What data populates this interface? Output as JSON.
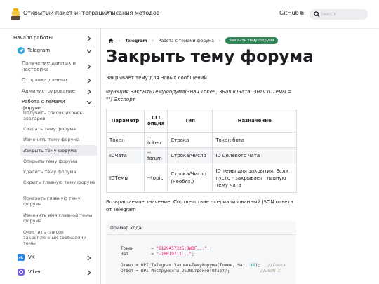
{
  "navbar": {
    "brand": "Открытый пакет интеграций",
    "methods_link": "Описания методов",
    "github": "GitHub",
    "search_placeholder": "Search"
  },
  "sidebar": {
    "items": [
      {
        "label": "Начало работы"
      },
      {
        "label": "Telegram"
      },
      {
        "label": "Получение данных и настройка"
      },
      {
        "label": "Отправка данных"
      },
      {
        "label": "Администрирование"
      },
      {
        "label": "Работа с темами форума"
      },
      {
        "label": "VK"
      },
      {
        "label": "Viber"
      }
    ],
    "sub_items": [
      {
        "label": "Получить список иконок-аватаров"
      },
      {
        "label": "Создать тему форума"
      },
      {
        "label": "Изменить тему форума"
      },
      {
        "label": "Закрыть тему форума"
      },
      {
        "label": "Открыть тему форума"
      },
      {
        "label": "Удалить тему форума"
      },
      {
        "label": "Скрыть главную тему форума"
      },
      {
        "label": "Показать главную тему форума"
      },
      {
        "label": "Изменить имя главной темы форума"
      },
      {
        "label": "Очистить список закрепленных сообщений темы"
      }
    ]
  },
  "breadcrumbs": {
    "items": [
      "Telegram",
      "Работа с темами форума"
    ],
    "active": "Закрыть тему форума"
  },
  "page": {
    "title": "Закрыть тему форума",
    "description": "Закрывает тему для новых сообщений",
    "signature": "Функция ЗакрытьТемуФорума(Знач Токен, Знач IDЧата, Знач IDТемы = \"\") Экспорт",
    "return_value": "Возвращаемое значение: Соответствие - сериализованный JSON ответа от Telegram"
  },
  "table": {
    "headers": [
      "Параметр",
      "CLI опция",
      "Тип",
      "Назначение"
    ],
    "rows": [
      [
        "Токен",
        "--token",
        "Строка",
        "Токен бота"
      ],
      [
        "IDЧата",
        "--forum",
        "Строка/Число",
        "ID целевого чата"
      ],
      [
        "IDТемы",
        "--topic",
        "Строка/Число (необяз.)",
        "ID темы для закрытия. Если пусто - закрывает главную тему чата"
      ]
    ]
  },
  "code": {
    "title": "Пример кода",
    "lines": {
      "l1_name": "Токен",
      "l1_val": "\"6129457325:BWDF...\"",
      "l2_name": "Чат",
      "l2_val": "\"-10019711...\"",
      "l3_pre": "Ответ = OPI_Telegram.ЗакрытьТемуФорума(Токен, Чат, ",
      "l3_num": "46",
      "l3_post": ");",
      "l3_cmt": "//Соотв",
      "l4": "Ответ = OPI_Инструменты.JSONСтрокой(Ответ);",
      "l4_cmt": "//JSON с"
    }
  },
  "colors": {
    "accent": "#2e8555",
    "telegram": "#2aa3df",
    "vk": "#2787f5",
    "viber": "#7360f2"
  }
}
